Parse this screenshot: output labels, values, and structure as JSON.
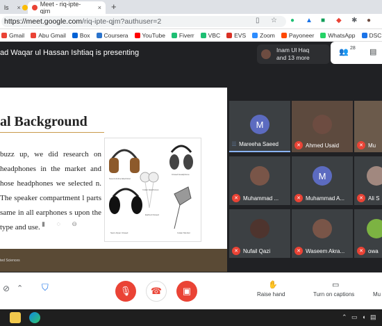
{
  "browser": {
    "tabs": [
      {
        "label": "ls",
        "active": false
      },
      {
        "label": "Meet - riq-ipte-qjm",
        "active": true
      }
    ],
    "close_glyph": "×",
    "new_tab_glyph": "+",
    "url_host": "https://meet.google.com",
    "url_path": "/riq-ipte-qjm?authuser=2",
    "bookmarks": [
      {
        "label": "Gmail",
        "color": "#ea4335"
      },
      {
        "label": "Abu Gmail",
        "color": "#ea4335"
      },
      {
        "label": "Box",
        "color": "#0061d5"
      },
      {
        "label": "Coursera",
        "color": "#2a73cc"
      },
      {
        "label": "YouTube",
        "color": "#ff0000"
      },
      {
        "label": "Fiverr",
        "color": "#1dbf73"
      },
      {
        "label": "VBC",
        "color": "#1dbf73"
      },
      {
        "label": "EVS",
        "color": "#d93025"
      },
      {
        "label": "Zoom",
        "color": "#2d8cff"
      },
      {
        "label": "Payoneer",
        "color": "#ff4800"
      },
      {
        "label": "WhatsApp",
        "color": "#25d366"
      },
      {
        "label": "DSC",
        "color": "#1a73e8"
      }
    ]
  },
  "meet": {
    "presenting_text": "ad Waqar ul Hassan Ishtiaq is presenting",
    "presenter_badge": {
      "line1": "Inam Ul Haq",
      "line2": "and 13 more"
    },
    "participant_count": "28",
    "slide": {
      "title": "al Background",
      "body": "buzz up, we did research on headphones in the market and hose headphones we selected n. The speaker compartment l parts same in all earphones s upon the type and use.",
      "footer": "ted Sciences",
      "image_labels": [
        "Sound Active Electrical",
        "Closed Headphone",
        "In-Ear Earphones",
        "Semi-Open Closed",
        "Earbud Closed",
        "In-Ear Monitor"
      ]
    },
    "participants": [
      {
        "name": "Mareeha Saeed",
        "initial": "M",
        "avatar_color": "#5c6bc0",
        "mic": "speaking"
      },
      {
        "name": "Ahmed Usaid",
        "initial": "",
        "avatar_color": "#6d4c41",
        "mic": "off"
      },
      {
        "name": "Mu",
        "initial": "",
        "avatar_color": "#8d6e63",
        "mic": "off"
      },
      {
        "name": "Muhammad ...",
        "initial": "",
        "avatar_color": "#795548",
        "mic": "off"
      },
      {
        "name": "Muhammad A...",
        "initial": "M",
        "avatar_color": "#5c6bc0",
        "mic": "off"
      },
      {
        "name": "Ali S",
        "initial": "",
        "avatar_color": "#a1887f",
        "mic": "off"
      },
      {
        "name": "Nufail Qazi",
        "initial": "",
        "avatar_color": "#4e342e",
        "mic": "off"
      },
      {
        "name": "Waseem Akra...",
        "initial": "",
        "avatar_color": "#795548",
        "mic": "off"
      },
      {
        "name": "owa",
        "initial": "",
        "avatar_color": "#7cb342",
        "mic": "off"
      }
    ],
    "controls": {
      "raise_hand": "Raise hand",
      "captions": "Turn on captions",
      "more": "Mu"
    }
  }
}
